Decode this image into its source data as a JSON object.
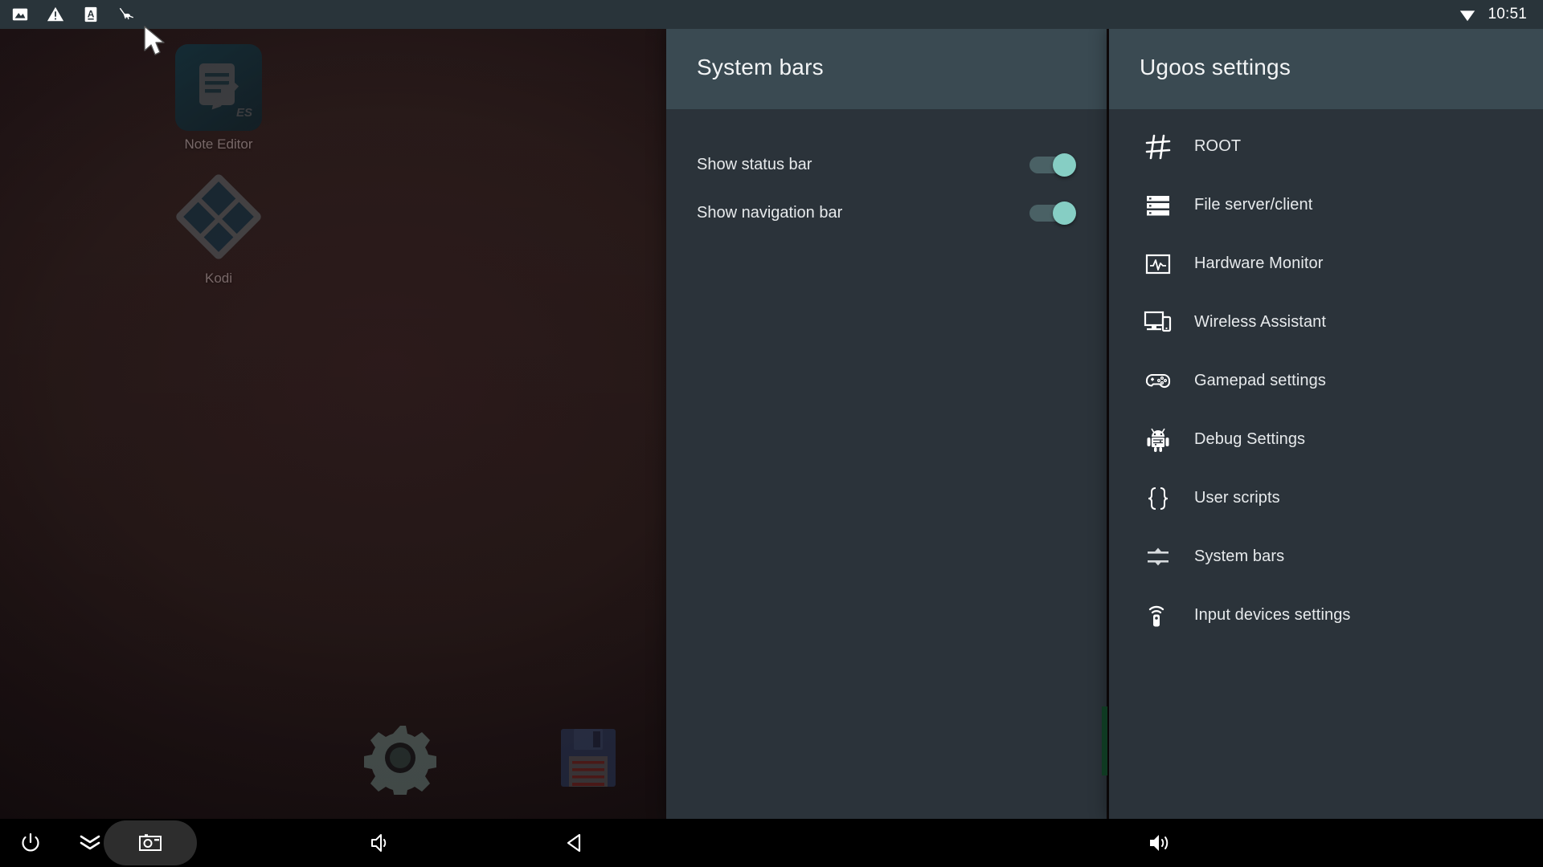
{
  "statusbar": {
    "icons": [
      {
        "name": "image-icon",
        "label": "Image"
      },
      {
        "name": "warning-icon",
        "label": "Warning"
      },
      {
        "name": "letter-a-icon",
        "label": "A"
      },
      {
        "name": "insect-icon",
        "label": "Insect"
      }
    ],
    "wifi_icon": "wifi-icon",
    "clock": "10:51"
  },
  "launcher": {
    "apps": [
      {
        "name": "note-editor",
        "label": "Note Editor",
        "badge": "ES"
      },
      {
        "name": "kodi",
        "label": "Kodi"
      }
    ],
    "dock": [
      {
        "name": "settings-gear-icon",
        "label": "Settings"
      },
      {
        "name": "floppy-save-icon",
        "label": "Save"
      }
    ]
  },
  "system_bars_panel": {
    "title": "System bars",
    "rows": [
      {
        "label": "Show status bar",
        "enabled": true
      },
      {
        "label": "Show navigation bar",
        "enabled": true
      }
    ]
  },
  "ugoos_panel": {
    "title": "Ugoos settings",
    "items": [
      {
        "label": "ROOT",
        "icon": "hash-icon"
      },
      {
        "label": "File server/client",
        "icon": "server-icon"
      },
      {
        "label": "Hardware Monitor",
        "icon": "monitor-pulse-icon"
      },
      {
        "label": "Wireless Assistant",
        "icon": "screen-phone-icon"
      },
      {
        "label": "Gamepad settings",
        "icon": "gamepad-icon"
      },
      {
        "label": "Debug Settings",
        "icon": "android-robot-icon"
      },
      {
        "label": "User scripts",
        "icon": "curly-braces-icon"
      },
      {
        "label": "System bars",
        "icon": "sliders-icon"
      },
      {
        "label": "Input devices settings",
        "icon": "remote-control-icon"
      }
    ]
  },
  "navbar": {
    "buttons": [
      {
        "name": "power-button",
        "icon": "power-icon",
        "label": "Power"
      },
      {
        "name": "collapse-button",
        "icon": "double-chevron-down-icon",
        "label": "Collapse"
      },
      {
        "name": "screenshot-button",
        "icon": "screenshot-icon",
        "label": "Screenshot",
        "pressed": true
      },
      {
        "name": "volume-button-left",
        "icon": "volume-icon",
        "label": "Volume"
      },
      {
        "name": "back-button",
        "icon": "back-triangle-icon",
        "label": "Back"
      },
      {
        "name": "volume-button-right",
        "icon": "volume-up-icon",
        "label": "Volume up"
      }
    ]
  },
  "colors": {
    "panel_body": "#2b333a",
    "panel_header": "#3a4a52",
    "statusbar": "#29343a",
    "toggle_on_knob": "#86cec4",
    "toggle_on_track": "#4a6165",
    "navbar": "#000000",
    "text_primary": "#e7eaec"
  }
}
